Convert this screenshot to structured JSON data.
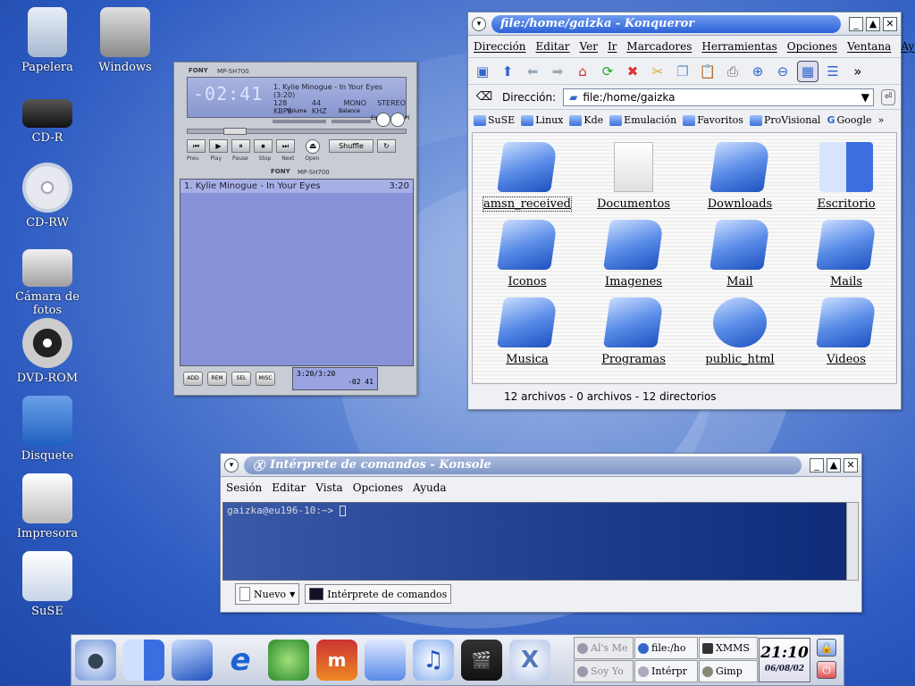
{
  "desktop": {
    "icons": [
      {
        "label": "Papelera",
        "icon": "trash-icon"
      },
      {
        "label": "Windows",
        "icon": "hard-drive-icon"
      },
      {
        "label": "CD-R",
        "icon": "cd-burner-icon"
      },
      {
        "label": "CD-RW",
        "icon": "cd-icon"
      },
      {
        "label": "Cámara de fotos",
        "icon": "camera-icon"
      },
      {
        "label": "DVD-ROM",
        "icon": "dvd-icon"
      },
      {
        "label": "Disquete",
        "icon": "floppy-icon"
      },
      {
        "label": "Impresora",
        "icon": "printer-icon"
      },
      {
        "label": "SuSE",
        "icon": "suse-monitor-icon"
      }
    ]
  },
  "konqueror": {
    "title": "file:/home/gaizka - Konqueror",
    "menu": [
      "Dirección",
      "Editar",
      "Ver",
      "Ir",
      "Marcadores",
      "Herramientas",
      "Opciones",
      "Ventana",
      "Ayuda"
    ],
    "address_label": "Dirección:",
    "address_value": "file:/home/gaizka",
    "bookmarks": [
      "SuSE",
      "Linux",
      "Kde",
      "Emulación",
      "Favoritos",
      "ProVisional",
      "Google"
    ],
    "files": [
      {
        "name": "amsn_received",
        "icon": "folder-icon"
      },
      {
        "name": "Documentos",
        "icon": "document-icon"
      },
      {
        "name": "Downloads",
        "icon": "folder-icon"
      },
      {
        "name": "Escritorio",
        "icon": "finder-icon"
      },
      {
        "name": "Iconos",
        "icon": "folder-icon"
      },
      {
        "name": "Imagenes",
        "icon": "folder-icon"
      },
      {
        "name": "Mail",
        "icon": "folder-icon"
      },
      {
        "name": "Mails",
        "icon": "folder-icon"
      },
      {
        "name": "Musica",
        "icon": "music-folder-icon"
      },
      {
        "name": "Programas",
        "icon": "folder-icon"
      },
      {
        "name": "public_html",
        "icon": "web-folder-icon"
      },
      {
        "name": "Videos",
        "icon": "video-folder-icon"
      }
    ],
    "status": "12 archivos - 0 archivos - 12 directorios"
  },
  "xmms": {
    "brand": "FONY",
    "model": "MP-SH700",
    "time": "-02:41",
    "song": "1. Kylie Minogue - In Your Eyes (3:20)",
    "bitrate": "128",
    "kbps": "KBPS",
    "khz_value": "44",
    "khz": "KHZ",
    "mono": "MONO",
    "stereo": "STEREO",
    "volume_label": "Volume",
    "balance_label": "Balance",
    "eq_label": "Eq",
    "pl_label": "Pl",
    "shuffle_label": "Shuffle",
    "open_label": "Open",
    "buttons": [
      "Prev.",
      "Play",
      "Pause",
      "Stop",
      "Next"
    ],
    "playlist": [
      {
        "title": "1. Kylie Minogue - In Your Eyes",
        "duration": "3:20"
      }
    ],
    "bottom_buttons": [
      "ADD",
      "REM",
      "SEL",
      "MISC"
    ],
    "mini_time": "3:20/3:20",
    "mini_remaining": "-02 41"
  },
  "konsole": {
    "title": "Intérprete de comandos - Konsole",
    "menu": [
      "Sesión",
      "Editar",
      "Vista",
      "Opciones",
      "Ayuda"
    ],
    "prompt": "gaizka@eu196-10:~>",
    "tab_new": "Nuevo",
    "tab_shell": "Intérprete de comandos"
  },
  "taskbar": {
    "tasks": [
      {
        "label": "Al's Me",
        "dim": true
      },
      {
        "label": "file:/ho",
        "dim": false
      },
      {
        "label": "XMMS",
        "dim": false
      },
      {
        "label": "Soy Yo",
        "dim": true
      },
      {
        "label": "Intérpr",
        "dim": false
      },
      {
        "label": "Gimp",
        "dim": false
      }
    ],
    "clock_time": "21:10",
    "clock_date": "06/08/02"
  }
}
